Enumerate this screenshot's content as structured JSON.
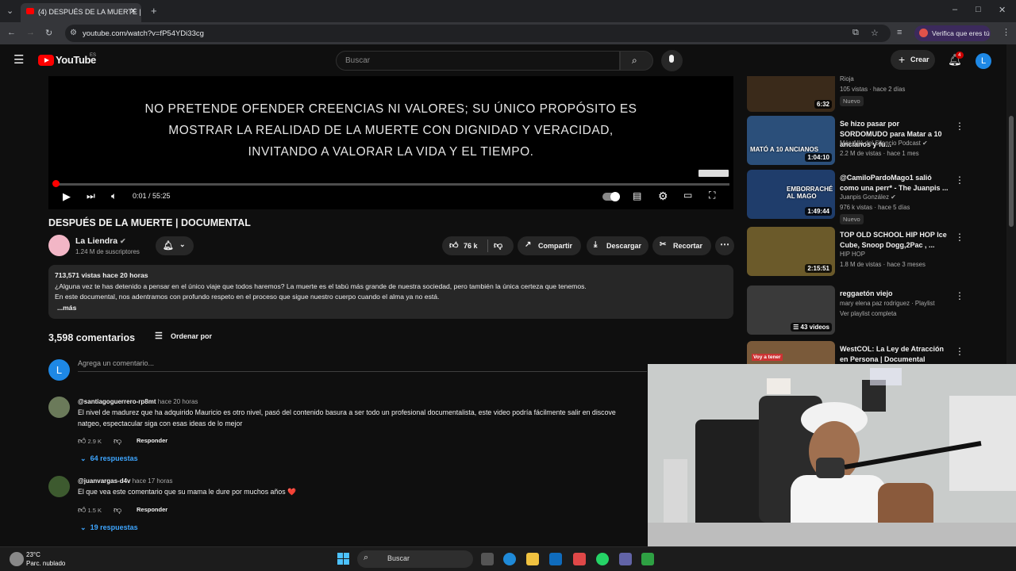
{
  "browser": {
    "tab_title": "(4) DESPUÉS DE LA MUERTE | D",
    "url": "youtube.com/watch?v=fP54YDi33cg",
    "verify_label": "Verifica que eres tú"
  },
  "header": {
    "logo_text": "YouTube",
    "logo_region": "ES",
    "search_placeholder": "Buscar",
    "create_label": "Crear",
    "notifications_count": "4",
    "avatar_letter": "L"
  },
  "video": {
    "overlay_lines": [
      "NO PRETENDE OFENDER CREENCIAS NI VALORES; SU ÚNICO PROPÓSITO ES",
      "MOSTRAR LA REALIDAD DE LA MUERTE CON DIGNIDAD Y VERACIDAD,",
      "INVITANDO A VALORAR LA VIDA Y EL TIEMPO."
    ],
    "time_display": "0:01 / 55:25",
    "progress_fraction": 0.0003,
    "title": "DESPUÉS DE LA MUERTE | DOCUMENTAL"
  },
  "channel": {
    "name": "La Liendra",
    "subscribers": "1.24 M de suscriptores"
  },
  "actions": {
    "likes": "76 k",
    "share": "Compartir",
    "download": "Descargar",
    "clip": "Recortar"
  },
  "description": {
    "stats": "713,571 vistas  hace 20 horas",
    "line1": "¿Alguna vez te has detenido a pensar en el único viaje que todos haremos? La muerte es el tabú más grande de nuestra sociedad, pero también la única certeza que tenemos.",
    "line2": "En este documental, nos adentramos con profundo respeto en el proceso que sigue nuestro cuerpo cuando el alma ya no está.",
    "more": "...más"
  },
  "comments": {
    "count_label": "3,598 comentarios",
    "sort_label": "Ordenar por",
    "add_placeholder": "Agrega un comentario...",
    "add_avatar_letter": "L",
    "items": [
      {
        "user": "@santiagoguerrero-rp8mt",
        "time": "hace 20 horas",
        "text_line1": "El nivel de madurez que ha adquirido Mauricio es otro nivel, pasó del contenido basura a ser todo un profesional documentalista, este video podría fácilmente salir en discove",
        "text_line2": "natgeo, espectacular siga con esas ideas de lo mejor",
        "likes": "2.9 K",
        "reply_label": "Responder",
        "replies": "64 respuestas"
      },
      {
        "user": "@juanvargas-d4v",
        "time": "hace 17 horas",
        "text_line1": "El que vea este comentario que su mama le dure por muchos años ❤️",
        "likes": "1.5 K",
        "reply_label": "Responder",
        "replies": "19 respuestas"
      }
    ]
  },
  "sidebar": {
    "items": [
      {
        "title": "",
        "meta1": "Rioja",
        "meta2": "105 vistas · hace 2 días",
        "badge": "Nuevo",
        "duration": "6:32",
        "thumb_color": "#3a2a1a"
      },
      {
        "title": "Se hizo pasar por SORDOMUDO para Matar a 10 ancianos y fu...",
        "meta1": "Más Allá del Silencio Podcast ✔",
        "meta2": "2.2 M de vistas · hace 1 mes",
        "badge": "",
        "duration": "1:04:10",
        "thumb_color": "#2b4f7a",
        "thumb_text": "MATÓ A 10 ANCIANOS"
      },
      {
        "title": "@CamiloPardoMago1 salió como una perr* - The Juanpis ...",
        "meta1": "Juanpis González ✔",
        "meta2": "976 k vistas · hace 5 días",
        "badge": "Nuevo",
        "duration": "1:49:44",
        "thumb_color": "#1f3d6b",
        "thumb_text": "EMBORRACHÉ AL MAGO"
      },
      {
        "title": "TOP OLD SCHOOL HIP HOP Ice Cube, Snoop Dogg,2Pac , ...",
        "meta1": "HIP HOP",
        "meta2": "1.8 M de vistas · hace 3 meses",
        "badge": "",
        "duration": "2:15:51",
        "thumb_color": "#6b5a2a"
      },
      {
        "title": "reggaetón viejo",
        "meta1": "mary elena paz rodriguez · Playlist",
        "meta2": "Ver playlist completa",
        "badge": "",
        "duration": "43 videos",
        "thumb_color": "#3a3a3a"
      },
      {
        "title": "WestCOL: La Ley de Atracción en Persona | Documental",
        "meta1": "",
        "meta2": "",
        "badge": "",
        "duration": "",
        "thumb_color": "#7a5a3a",
        "thumb_text": "Voy a tener"
      }
    ]
  },
  "taskbar": {
    "temperature": "23°C",
    "weather": "Parc. nublado",
    "search_label": "Buscar"
  }
}
